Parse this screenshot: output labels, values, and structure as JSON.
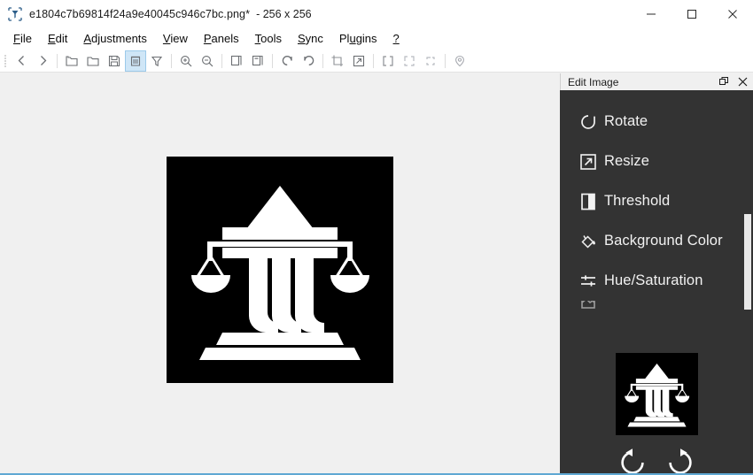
{
  "window": {
    "app_icon": "filter-funnel-icon",
    "filename": "e1804c7b69814f24a9e40045c946c7bc.png*",
    "dimensions": "- 256 x 256",
    "minimize_label": "—",
    "maximize_label": "□",
    "close_label": "✕"
  },
  "menubar": {
    "items": [
      {
        "name": "file",
        "pre": "",
        "key": "F",
        "post": "ile"
      },
      {
        "name": "edit",
        "pre": "",
        "key": "E",
        "post": "dit"
      },
      {
        "name": "adjustments",
        "pre": "",
        "key": "A",
        "post": "djustments"
      },
      {
        "name": "view",
        "pre": "",
        "key": "V",
        "post": "iew"
      },
      {
        "name": "panels",
        "pre": "",
        "key": "P",
        "post": "anels"
      },
      {
        "name": "tools",
        "pre": "",
        "key": "T",
        "post": "ools"
      },
      {
        "name": "sync",
        "pre": "",
        "key": "S",
        "post": "ync"
      },
      {
        "name": "plugins",
        "pre": "Pl",
        "key": "u",
        "post": "gins"
      },
      {
        "name": "help",
        "pre": "",
        "key": "?",
        "post": ""
      }
    ]
  },
  "toolbar": {
    "buttons": [
      {
        "name": "back-icon",
        "tip": "Back"
      },
      {
        "name": "forward-icon",
        "tip": "Forward"
      },
      {
        "name": "open-folder-icon",
        "tip": "Open"
      },
      {
        "name": "folder-icon",
        "tip": "Open Folder"
      },
      {
        "name": "save-icon",
        "tip": "Save"
      },
      {
        "name": "delete-icon",
        "tip": "Delete",
        "active": true
      },
      {
        "name": "filter-icon",
        "tip": "Filter"
      },
      {
        "name": "zoom-in-icon",
        "tip": "Zoom In"
      },
      {
        "name": "zoom-out-icon",
        "tip": "Zoom Out"
      },
      {
        "name": "copy-icon",
        "tip": "Copy"
      },
      {
        "name": "paste-icon",
        "tip": "Paste"
      },
      {
        "name": "undo-icon",
        "tip": "Undo"
      },
      {
        "name": "redo-icon",
        "tip": "Redo"
      },
      {
        "name": "crop-icon",
        "tip": "Crop"
      },
      {
        "name": "resize-icon",
        "tip": "Resize"
      },
      {
        "name": "select-all-icon",
        "tip": "Select All"
      },
      {
        "name": "select-partial-icon",
        "tip": "Select Partial"
      },
      {
        "name": "select-corner-icon",
        "tip": "Select Corner"
      },
      {
        "name": "location-pin-icon",
        "tip": "Location"
      }
    ]
  },
  "canvas": {
    "image_alt": "courthouse-scales-of-justice-glyph",
    "background": "#000000",
    "foreground": "#ffffff"
  },
  "panel": {
    "title": "Edit Image",
    "float_label": "❐",
    "close_label": "✕",
    "items": [
      {
        "name": "rotate",
        "label": "Rotate",
        "icon": "rotate-ccw-icon"
      },
      {
        "name": "resize",
        "label": "Resize",
        "icon": "resize-arrow-icon"
      },
      {
        "name": "threshold",
        "label": "Threshold",
        "icon": "threshold-half-square-icon"
      },
      {
        "name": "background-color",
        "label": "Background Color",
        "icon": "paint-bucket-icon"
      },
      {
        "name": "hue-saturation",
        "label": "Hue/Saturation",
        "icon": "sliders-icon"
      },
      {
        "name": "clipped",
        "label": "",
        "icon": "clipped-icon"
      }
    ],
    "preview": {
      "alt": "courthouse-scales-of-justice-thumbnail",
      "rotate_left": "rotate-left-icon",
      "rotate_right": "rotate-right-icon"
    }
  },
  "colors": {
    "chrome": "#ffffff",
    "canvas_bg": "#f0f0f0",
    "panel_bg": "#333333",
    "panel_title_bg": "#f0f0f0",
    "accent": "#5fa8d3",
    "toolbar_active": "#cfe6f7",
    "panel_text": "#f2f2f2"
  }
}
